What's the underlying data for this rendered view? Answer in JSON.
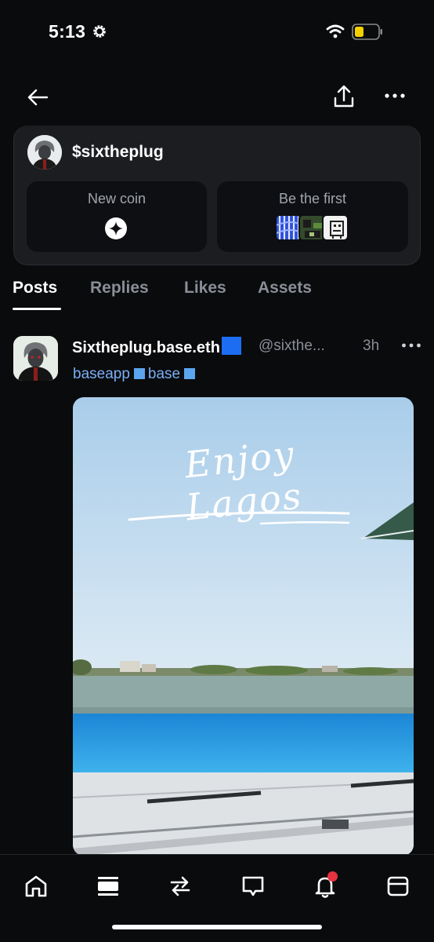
{
  "status_bar": {
    "time": "5:13",
    "icons": [
      "gear-icon",
      "wifi-icon",
      "battery-icon"
    ],
    "battery_color": "#f5d000"
  },
  "header": {
    "icons": [
      "back-arrow-icon",
      "share-icon",
      "more-icon"
    ]
  },
  "profile": {
    "name": "$sixtheplug",
    "new_coin_label": "New coin",
    "be_first_label": "Be the first"
  },
  "tabs": [
    {
      "label": "Posts",
      "active": true
    },
    {
      "label": "Replies",
      "active": false
    },
    {
      "label": "Likes",
      "active": false
    },
    {
      "label": "Assets",
      "active": false
    }
  ],
  "post": {
    "author": "Sixtheplug.base.eth",
    "handle": "@sixthe...",
    "time": "3h",
    "tags": [
      "baseapp",
      "base"
    ],
    "media_caption": "Enjoy Lagos"
  },
  "tab_bar": {
    "icons": [
      "home-icon",
      "feed-icon",
      "swap-icon",
      "messages-icon",
      "notifications-icon",
      "wallet-icon"
    ],
    "notification_dot_color": "#e8323f"
  },
  "colors": {
    "background": "#0a0b0d",
    "card": "#1c1d21",
    "link": "#7aaef5",
    "verified": "#1d6df2"
  }
}
